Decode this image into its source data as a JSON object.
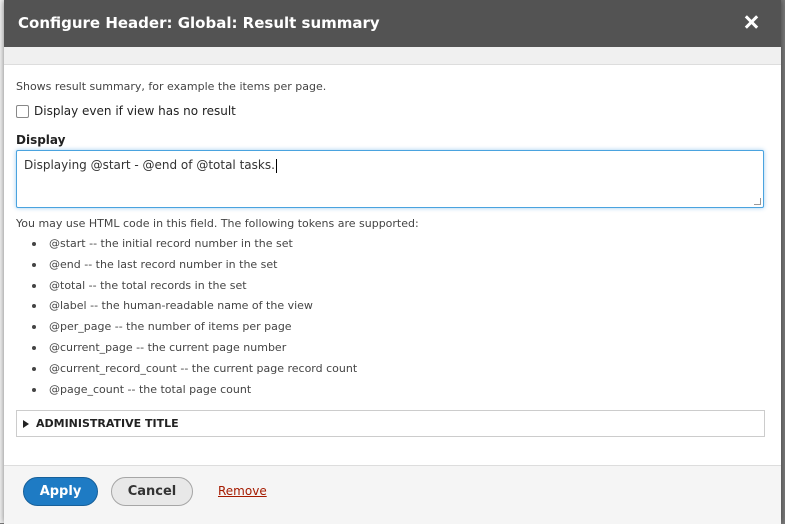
{
  "dialog": {
    "title": "Configure Header: Global: Result summary",
    "close_icon": "close-icon"
  },
  "form": {
    "description": "Shows result summary, for example the items per page.",
    "checkbox_label": "Display even if view has no result",
    "checkbox_checked": false,
    "display_label": "Display",
    "display_value": "Displaying @start - @end of @total tasks.",
    "hint": "You may use HTML code in this field. The following tokens are supported:",
    "tokens": [
      "@start -- the initial record number in the set",
      "@end -- the last record number in the set",
      "@total -- the total records in the set",
      "@label -- the human-readable name of the view",
      "@per_page -- the number of items per page",
      "@current_page -- the current page number",
      "@current_record_count -- the current page record count",
      "@page_count -- the total page count"
    ],
    "details_label": "ADMINISTRATIVE TITLE"
  },
  "footer": {
    "apply_label": "Apply",
    "cancel_label": "Cancel",
    "remove_label": "Remove"
  },
  "colors": {
    "titlebar": "#535353",
    "primary_button": "#1e7bc4",
    "focus": "#4aa3df",
    "remove_link": "#a51b00"
  }
}
